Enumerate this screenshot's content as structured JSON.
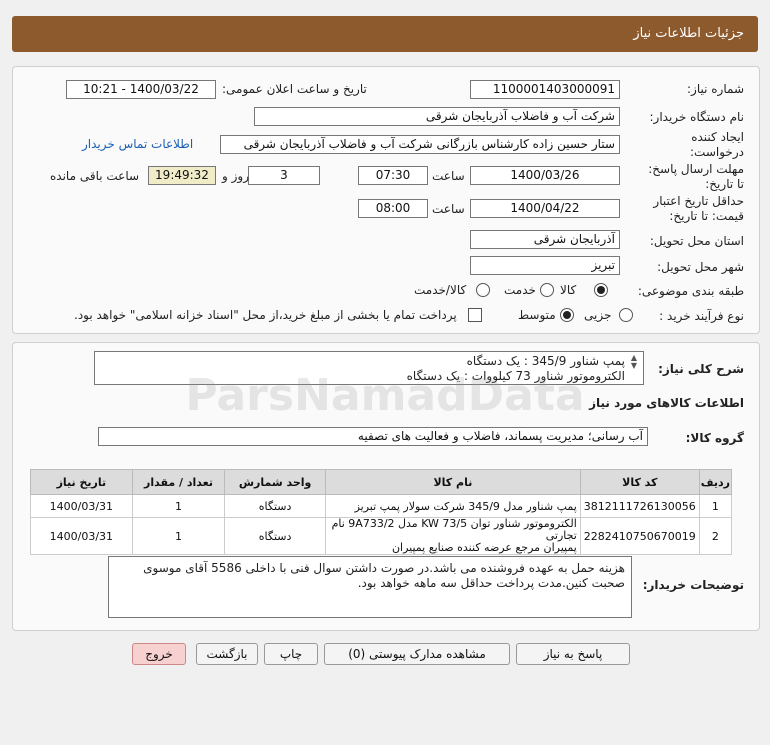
{
  "header": {
    "title": "جزئیات اطلاعات نیاز"
  },
  "form": {
    "need_number_label": "شماره نیاز:",
    "need_number": "1100001403000091",
    "announce_label": "تاریخ و ساعت اعلان عمومی:",
    "announce_value": "1400/03/22 - 10:21",
    "buyer_org_label": "نام دستگاه خریدار:",
    "buyer_org": "شرکت آب و فاضلاب آذربایجان شرقی",
    "creator_label": "ایجاد کننده درخواست:",
    "creator": "ستار حسین زاده کارشناس بازرگانی شرکت آب و فاضلاب آذربایجان شرقی",
    "contact_link": "اطلاعات تماس خریدار",
    "deadline_label": "مهلت ارسال پاسخ: تا تاریخ:",
    "deadline_date": "1400/03/26",
    "time_label": "ساعت",
    "deadline_time": "07:30",
    "days": "3",
    "days_label": "روز و",
    "remaining_time": "19:49:32",
    "remaining_label": "ساعت باقی مانده",
    "validity_label": "حداقل تاریخ اعتبار قیمت: تا تاریخ:",
    "validity_date": "1400/04/22",
    "validity_time": "08:00",
    "province_label": "استان محل تحویل:",
    "province": "آذربایجان شرقی",
    "city_label": "شهر محل تحویل:",
    "city": "تبریز",
    "category_label": "طبقه بندی موضوعی:",
    "category_options": [
      "کالا",
      "خدمت",
      "کالا/خدمت"
    ],
    "process_label": "نوع فرآیند خرید :",
    "process_options": [
      "جزیی",
      "متوسط"
    ],
    "payment_note": "پرداخت تمام یا بخشی از مبلغ خرید،از محل \"اسناد خزانه اسلامی\" خواهد بود."
  },
  "description": {
    "label": "شرح کلی نیاز:",
    "line1": "پمپ شناور 345/9 : یک دستگاه",
    "line2": "الکتروموتور شناور 73 کیلووات : یک دستگاه"
  },
  "goods": {
    "section_title": "اطلاعات کالاهای مورد نیاز",
    "group_label": "گروه کالا:",
    "group_value": "آب رسانی؛ مدیریت پسماند، فاضلاب و فعالیت های تصفیه",
    "columns": [
      "ردیف",
      "کد کالا",
      "نام کالا",
      "واحد شمارش",
      "تعداد / مقدار",
      "تاریخ نیاز"
    ],
    "rows": [
      {
        "idx": "1",
        "code": "3812111726130056",
        "name1": "پمپ شناور مدل 345/9 شرکت سولار پمپ تبریز",
        "name2": "",
        "unit": "دستگاه",
        "qty": "1",
        "date": "1400/03/31"
      },
      {
        "idx": "2",
        "code": "2282410750670019",
        "name1": "الکتروموتور شناور توان KW 73/5 مدل 9A733/2 نام تجارتی",
        "name2": "پمپیران مرجع عرضه کننده صنایع پمپیران",
        "unit": "دستگاه",
        "qty": "1",
        "date": "1400/03/31"
      }
    ]
  },
  "buyer_notes": {
    "label": "توضیحات خریدار:",
    "line1": "هزینه حمل به عهده فروشنده می باشد.در صورت داشتن سوال فنی با داخلی 5586 آقای موسوی",
    "line2": "صحبت کنین.مدت پرداخت حداقل سه ماهه خواهد بود."
  },
  "buttons": {
    "reply": "پاسخ به نیاز",
    "docs": "مشاهده مدارک پیوستی (0)",
    "print": "چاپ",
    "back": "بازگشت",
    "exit": "خروج"
  },
  "watermark": "ParsNamadData"
}
